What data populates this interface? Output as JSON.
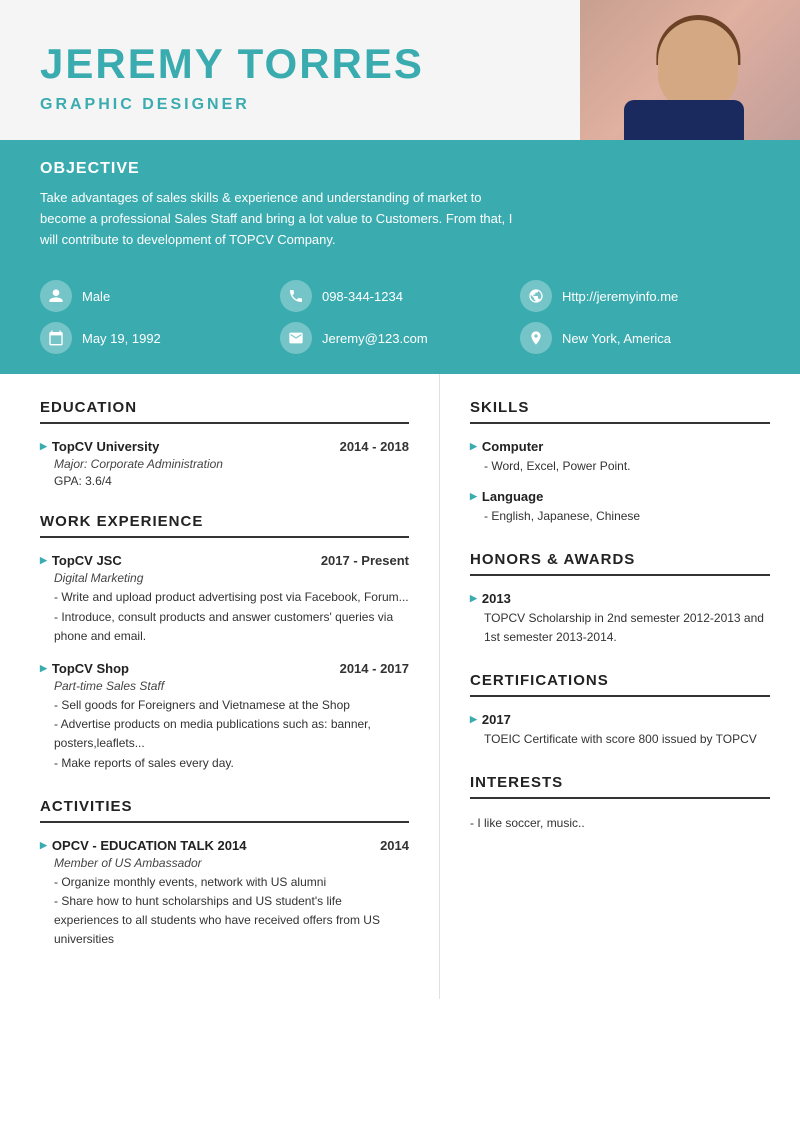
{
  "header": {
    "name": "JEREMY TORRES",
    "title": "GRAPHIC DESIGNER"
  },
  "objective": {
    "section_title": "OBJECTIVE",
    "text": "Take advantages of sales skills & experience and understanding of market to become a professional Sales Staff and bring a lot value to Customers. From that, I will contribute to development of TOPCV Company."
  },
  "info": [
    {
      "label": "Male",
      "icon": "person"
    },
    {
      "label": "098-344-1234",
      "icon": "phone"
    },
    {
      "label": "Http://jeremyinfo.me",
      "icon": "globe"
    },
    {
      "label": "May 19, 1992",
      "icon": "calendar"
    },
    {
      "label": "Jeremy@123.com",
      "icon": "email"
    },
    {
      "label": "New York, America",
      "icon": "location"
    }
  ],
  "education": {
    "section_title": "EDUCATION",
    "items": [
      {
        "org": "TopCV University",
        "years": "2014 - 2018",
        "sub": "Major: Corporate Administration",
        "gpa": "GPA: 3.6/4"
      }
    ]
  },
  "work_experience": {
    "section_title": "WORK EXPERIENCE",
    "items": [
      {
        "org": "TopCV JSC",
        "years": "2017 - Present",
        "sub": "Digital Marketing",
        "details": [
          "- Write and upload product advertising post via Facebook, Forum...",
          "- Introduce, consult products and answer customers' queries via phone and email."
        ]
      },
      {
        "org": "TopCV Shop",
        "years": "2014 - 2017",
        "sub": "Part-time Sales Staff",
        "details": [
          "- Sell goods for Foreigners and Vietnamese at the Shop",
          "- Advertise products on media publications such as: banner, posters,leaflets...",
          "- Make reports of sales every day."
        ]
      }
    ]
  },
  "activities": {
    "section_title": "ACTIVITIES",
    "items": [
      {
        "org": "OPCV - EDUCATION TALK 2014",
        "years": "2014",
        "sub": "Member of US Ambassador",
        "details": [
          "- Organize monthly events, network with US alumni",
          "- Share how to hunt scholarships and US student's life experiences to all students who have received offers from US universities"
        ]
      }
    ]
  },
  "skills": {
    "section_title": "SKILLS",
    "items": [
      {
        "title": "Computer",
        "detail": "- Word, Excel, Power Point."
      },
      {
        "title": "Language",
        "detail": "- English, Japanese, Chinese"
      }
    ]
  },
  "honors": {
    "section_title": "HONORS & AWARDS",
    "items": [
      {
        "year": "2013",
        "desc": "TOPCV Scholarship in 2nd semester 2012-2013 and 1st semester 2013-2014."
      }
    ]
  },
  "certifications": {
    "section_title": "CERTIFICATIONS",
    "items": [
      {
        "year": "2017",
        "desc": "TOEIC Certificate with score 800 issued by TOPCV"
      }
    ]
  },
  "interests": {
    "section_title": "INTERESTS",
    "text": "- I like soccer, music.."
  }
}
